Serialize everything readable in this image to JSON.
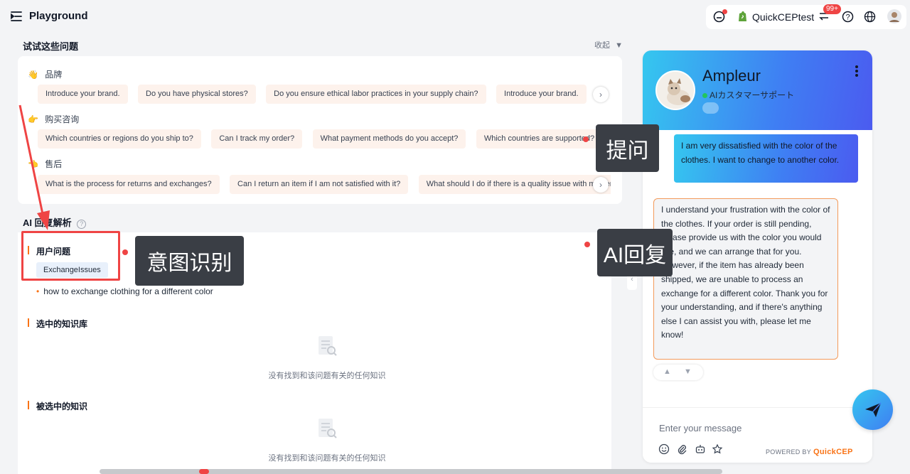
{
  "header": {
    "title": "Playground",
    "account_name": "QuickCEPtest",
    "notification_badge": "99+"
  },
  "try_questions": {
    "title": "试试这些问题",
    "collapse_label": "收起",
    "categories": [
      {
        "emoji": "👋",
        "label": "品牌",
        "chips": [
          "Introduce your brand.",
          "Do you have physical stores?",
          "Do you ensure ethical labor practices in your supply chain?",
          "Introduce your brand."
        ]
      },
      {
        "emoji": "👉",
        "label": "购买咨询",
        "chips": [
          "Which countries or regions do you ship to?",
          "Can I track my order?",
          "What payment methods do you accept?",
          "Which countries are supported?"
        ]
      },
      {
        "emoji": "👈",
        "label": "售后",
        "chips": [
          "What is the process for returns and exchanges?",
          "Can I return an item if I am not satisfied with it?",
          "What should I do if there is a quality issue with my item?"
        ]
      }
    ]
  },
  "analysis": {
    "title": "AI 回复解析",
    "user_question_label": "用户问题",
    "intent_tag": "ExchangeIssues",
    "intent_text": "how to exchange clothing for a different color",
    "selected_kb_label": "选中的知识库",
    "selected_knowledge_label": "被选中的知识",
    "empty_text": "没有找到和该问题有关的任何知识"
  },
  "annotations": {
    "ask": "提问",
    "intent": "意图识别",
    "reply": "AI回复"
  },
  "chat": {
    "bot_name": "Ampleur",
    "bot_status": "AIカスタマーサポート",
    "user_message": "I am very dissatisfied with the color of the clothes. I want to change to another color.",
    "bot_message": "I understand your frustration with the color of the clothes. If your order is still pending, please provide us with the color you would like, and we can arrange that for you. However, if the item has already been shipped, we are unable to process an exchange for a different color. Thank you for your understanding, and if there's anything else I can assist you with, please let me know!",
    "input_placeholder": "Enter your message",
    "powered_by": "POWERED BY",
    "powered_brand": "QuickCEP"
  },
  "colors": {
    "accent_orange": "#f97316",
    "annotation_red": "#ef4444",
    "chat_gradient_start": "#35c7ef",
    "chat_gradient_end": "#4b5bf0"
  }
}
